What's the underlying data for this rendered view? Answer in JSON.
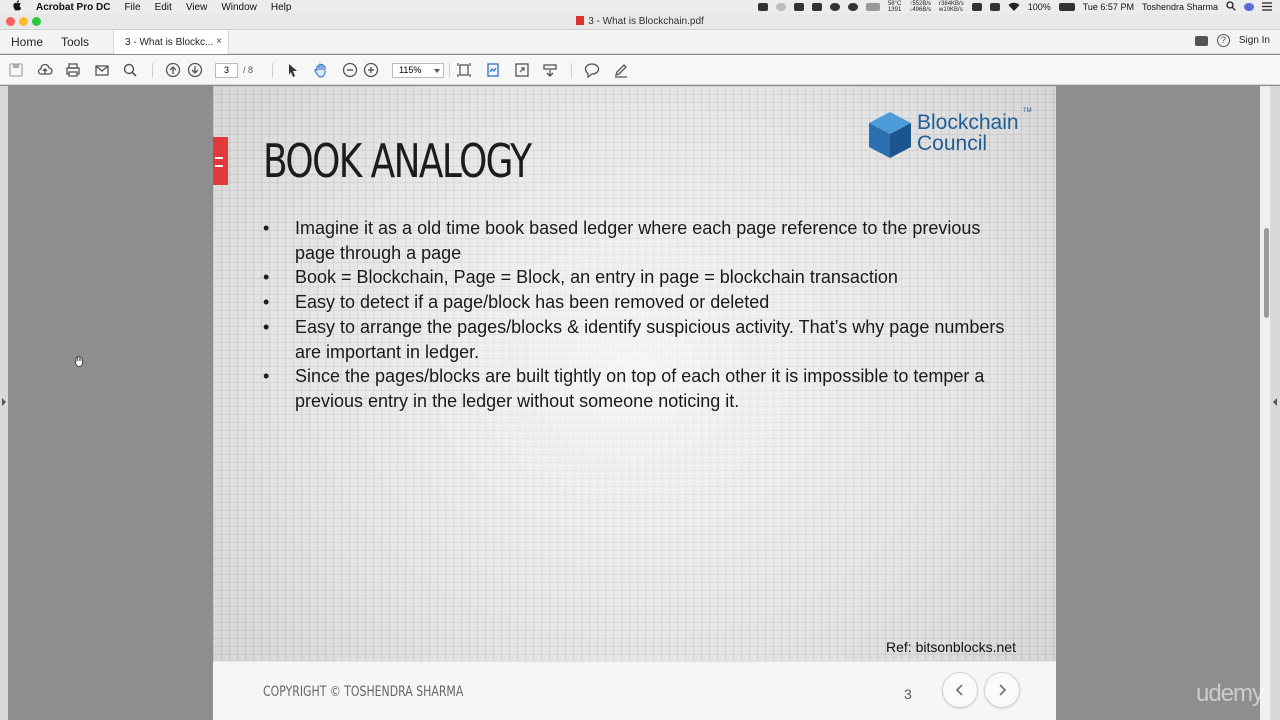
{
  "menubar": {
    "app_name": "Acrobat Pro DC",
    "items": [
      "File",
      "Edit",
      "View",
      "Window",
      "Help"
    ],
    "status": {
      "temp": "58°C",
      "fan": "1391",
      "net_up": "↑552B/s",
      "net_down": "↓496B/s",
      "disk_read": "r384KB/s",
      "disk_write": "w10KB/s",
      "battery": "100%",
      "clock": "Tue 6:57 PM",
      "user": "Toshendra Sharma"
    }
  },
  "window": {
    "title": "3 - What is Blockchain.pdf"
  },
  "header": {
    "home": "Home",
    "tools": "Tools",
    "tab_label": "3 - What is Blockc...",
    "tab_close": "×",
    "sign_in": "Sign In",
    "help_glyph": "?"
  },
  "toolbar": {
    "page_current": "3",
    "page_total": "/ 8",
    "zoom": "115%"
  },
  "slide": {
    "title": "BOOK ANALOGY",
    "logo_line1": "Blockchain",
    "logo_line2": "Council",
    "logo_tm": "TM",
    "bullet_glyph": "•",
    "bullets": [
      "Imagine it as a old time book based ledger where each page reference to the previous page through a page",
      "Book = Blockchain, Page = Block, an entry in page = blockchain transaction",
      "Easy to detect if a page/block has been removed or deleted",
      "Easy to arrange the pages/blocks & identify suspicious activity. That’s why page numbers are important in ledger.",
      "Since the pages/blocks are built tightly on top of each other it is impossible to temper a previous entry in the ledger without someone noticing it."
    ],
    "ref": "Ref: bitsonblocks.net",
    "copyright": "COPYRIGHT © TOSHENDRA SHARMA",
    "page_number": "3"
  },
  "watermark": "udemy",
  "colors": {
    "accent_red": "#e03a3a",
    "logo_blue": "#1f5e93"
  }
}
